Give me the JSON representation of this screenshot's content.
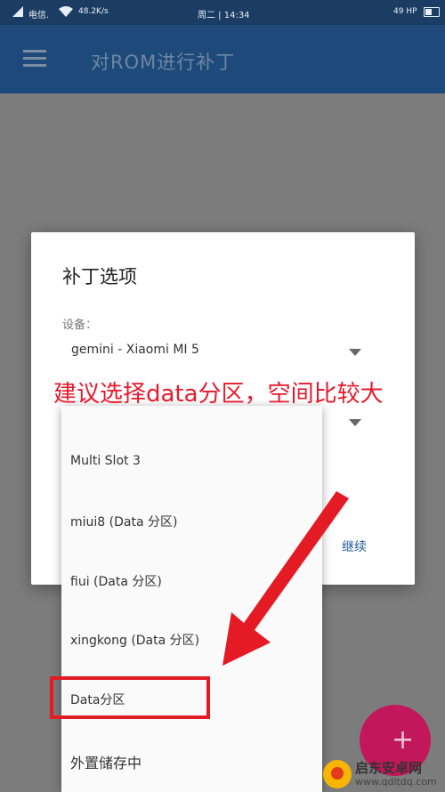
{
  "status_bar": {
    "carrier": "电信.",
    "speed": "48.2K/s",
    "clock": "周二 | 14:34",
    "battery": "49 HP"
  },
  "app_bar": {
    "title": "对ROM进行补丁"
  },
  "dialog": {
    "title": "补丁选项",
    "device_label": "设备：",
    "device_value": "gemini - Xiaomi MI 5",
    "continue_label": "继续"
  },
  "annotation": {
    "text": "建议选择data分区，空间比较大",
    "color": "#e8192c"
  },
  "dropdown": {
    "items": [
      "Multi Slot 3",
      "miui8 (Data 分区)",
      "fiui (Data 分区)",
      "xingkong (Data 分区)",
      "Data分区",
      "外置储存中"
    ],
    "highlighted_item": "Data分区"
  },
  "fab": {
    "icon": "plus-icon"
  },
  "watermark": {
    "name": "启东安卓网",
    "url": "www.qdltdq.com"
  },
  "colors": {
    "app_bar": "#1d4a7a",
    "accent": "#1f5c9e",
    "fab": "#c2185b",
    "annotation_red": "#e41a24"
  }
}
